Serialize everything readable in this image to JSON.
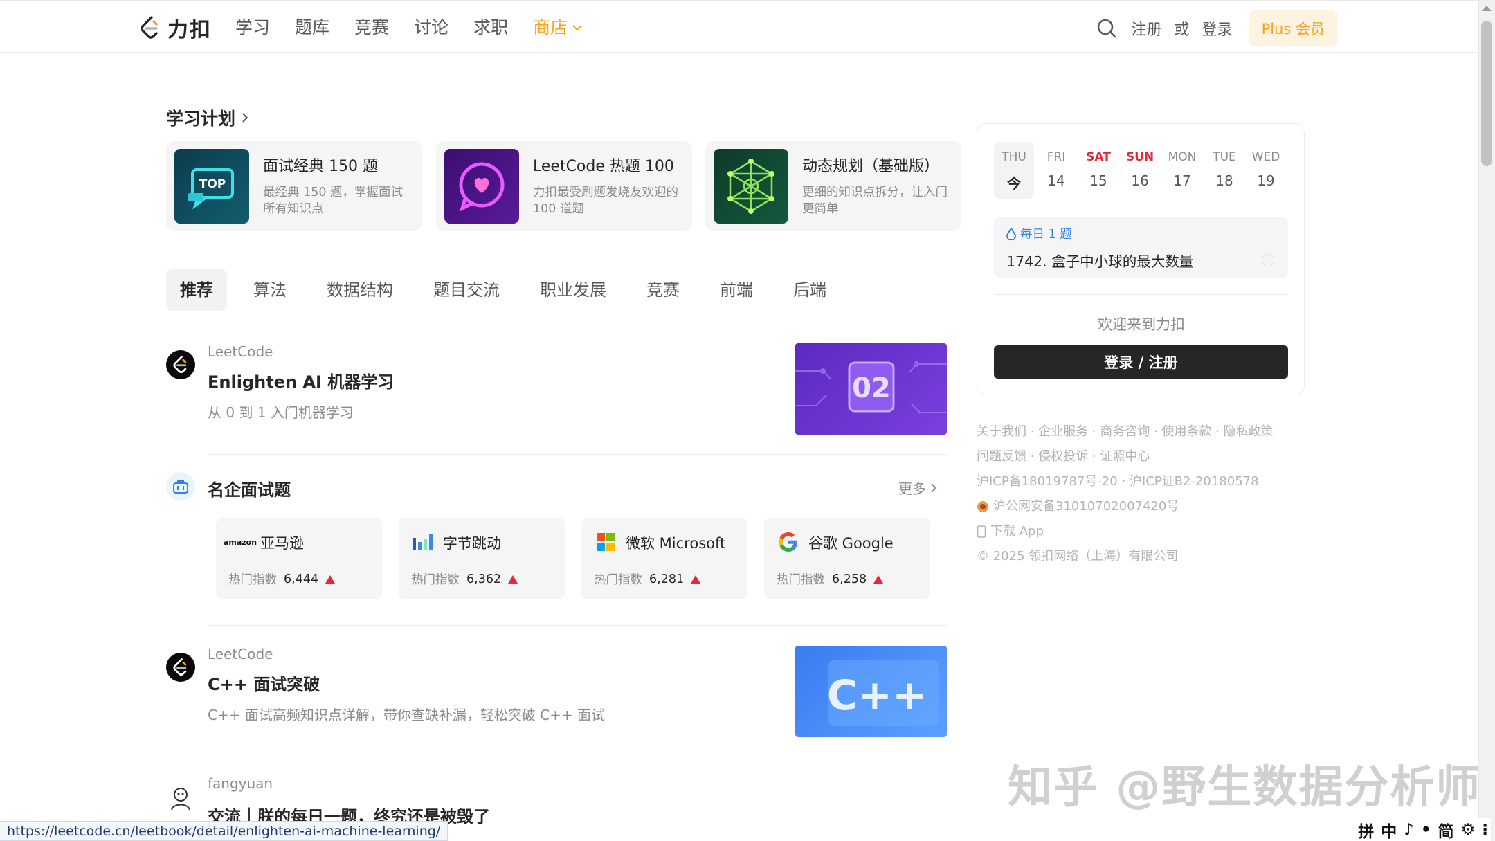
{
  "nav": {
    "logo_text": "力扣",
    "links": [
      "学习",
      "题库",
      "竞赛",
      "讨论",
      "求职"
    ],
    "store_label": "商店",
    "register": "注册",
    "or": "或",
    "login": "登录",
    "plus": "Plus 会员"
  },
  "study_plan": {
    "title": "学习计划",
    "cards": [
      {
        "name": "面试经典 150 题",
        "desc": "最经典 150 题，掌握面试所有知识点"
      },
      {
        "name": "LeetCode 热题 100",
        "desc": "力扣最受刷题发烧友欢迎的 100 道题"
      },
      {
        "name": "动态规划（基础版）",
        "desc": "更细的知识点拆分，让入门更简单"
      }
    ]
  },
  "tabs": [
    "推荐",
    "算法",
    "数据结构",
    "题目交流",
    "职业发展",
    "竞赛",
    "前端",
    "后端"
  ],
  "feed": [
    {
      "author": "LeetCode",
      "title": "Enlighten AI 机器学习",
      "desc": "从 0 到 1 入门机器学习",
      "img_text": "02"
    },
    {
      "author": "LeetCode",
      "title": "C++ 面试突破",
      "desc": "C++ 面试高频知识点详解，带你查缺补漏，轻松突破 C++ 面试",
      "img_text": "C++"
    },
    {
      "author": "fangyuan",
      "title": "交流｜朕的每日一题，终究还是被毁了"
    }
  ],
  "companies": {
    "title": "名企面试题",
    "more": "更多",
    "hot_label": "热门指数",
    "items": [
      {
        "name": "亚马逊",
        "logo_text": "amazon",
        "hot": "6,444"
      },
      {
        "name": "字节跳动",
        "hot": "6,362"
      },
      {
        "name": "微软 Microsoft",
        "hot": "6,281"
      },
      {
        "name": "谷歌 Google",
        "hot": "6,258"
      }
    ]
  },
  "calendar": {
    "days": [
      {
        "name": "THU",
        "date": "今"
      },
      {
        "name": "FRI",
        "date": "14"
      },
      {
        "name": "SAT",
        "date": "15"
      },
      {
        "name": "SUN",
        "date": "16"
      },
      {
        "name": "MON",
        "date": "17"
      },
      {
        "name": "TUE",
        "date": "18"
      },
      {
        "name": "WED",
        "date": "19"
      }
    ],
    "daily_tag": "每日 1 题",
    "daily_question": "1742. 盒子中小球的最大数量",
    "welcome": "欢迎来到力扣",
    "login_button": "登录 / 注册"
  },
  "footer": {
    "line1": "关于我们 · 企业服务 · 商务咨询 · 使用条款 · 隐私政策",
    "line2": "问题反馈 · 侵权投诉 · 证照中心",
    "line3": "沪ICP备18019787号-20 · 沪ICP证B2-20180578",
    "line4": "沪公网安备31010702007420号",
    "line5": "下载 App",
    "line6": "© 2025 领扣网络（上海）有限公司"
  },
  "status_url": "https://leetcode.cn/leetbook/detail/enlighten-ai-machine-learning/",
  "watermark": "知乎 @野生数据分析师",
  "ime": [
    "拼",
    "中",
    "♪",
    "•",
    "简",
    "⚙",
    "⁝"
  ],
  "colors": {
    "accent": "#ffa116",
    "blue": "#2f80ed",
    "red": "#e8253a",
    "dark": "#262626"
  }
}
